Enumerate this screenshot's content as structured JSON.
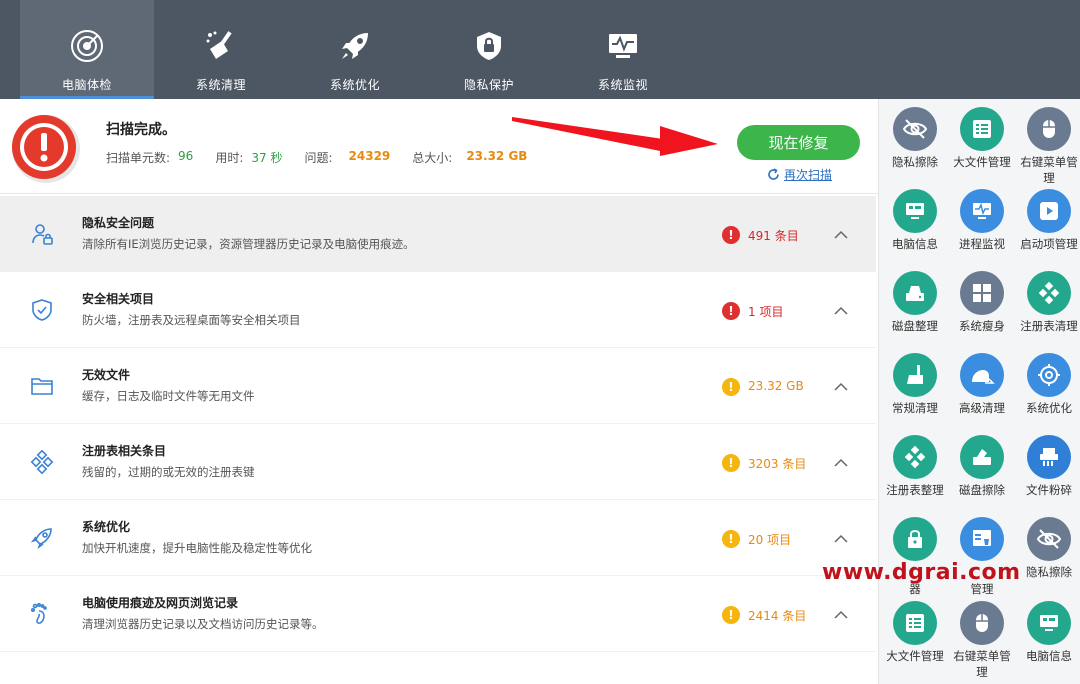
{
  "nav": {
    "tabs": [
      {
        "label": "电脑体检",
        "icon": "radar-icon"
      },
      {
        "label": "系统清理",
        "icon": "broom-icon"
      },
      {
        "label": "系统优化",
        "icon": "rocket-icon"
      },
      {
        "label": "隐私保护",
        "icon": "lock-shield-icon"
      },
      {
        "label": "系统监视",
        "icon": "monitor-icon"
      }
    ]
  },
  "summary": {
    "title": "扫描完成。",
    "units_label": "扫描单元数:",
    "units_value": "96",
    "time_label": "用时:",
    "time_value": "37 秒",
    "issues_label": "问题:",
    "issues_value": "24329",
    "size_label": "总大小:",
    "size_value": "23.32 GB",
    "fix_button": "现在修复",
    "rescan_link": "再次扫描"
  },
  "issues": [
    {
      "title": "隐私安全问题",
      "desc": "清除所有IE浏览历史记录，资源管理器历史记录及电脑使用痕迹。",
      "count": "491 条目",
      "severity": "red",
      "icon": "user-lock-icon"
    },
    {
      "title": "安全相关项目",
      "desc": "防火墙，注册表及远程桌面等安全相关项目",
      "count": "1 项目",
      "severity": "red",
      "icon": "shield-check-icon"
    },
    {
      "title": "无效文件",
      "desc": "缓存，日志及临时文件等无用文件",
      "count": "23.32 GB",
      "severity": "yellow",
      "icon": "folder-icon"
    },
    {
      "title": "注册表相关条目",
      "desc": "残留的，过期的或无效的注册表键",
      "count": "3203 条目",
      "severity": "yellow",
      "icon": "registry-icon"
    },
    {
      "title": "系统优化",
      "desc": "加快开机速度，提升电脑性能及稳定性等优化",
      "count": "20 项目",
      "severity": "yellow",
      "icon": "rocket-icon"
    },
    {
      "title": "电脑使用痕迹及网页浏览记录",
      "desc": "清理浏览器历史记录以及文档访问历史记录等。",
      "count": "2414 条目",
      "severity": "yellow",
      "icon": "footprint-icon"
    }
  ],
  "tools": [
    {
      "label": "隐私擦除",
      "icon": "eye-off-icon",
      "color": "#6a7a90"
    },
    {
      "label": "大文件管理",
      "icon": "file-list-icon",
      "color": "#23a88e"
    },
    {
      "label": "右键菜单管理",
      "icon": "mouse-icon",
      "color": "#6a7a90"
    },
    {
      "label": "电脑信息",
      "icon": "computer-icon",
      "color": "#23a88e"
    },
    {
      "label": "进程监视",
      "icon": "monitor-pulse-icon",
      "color": "#3b8de0"
    },
    {
      "label": "启动项管理",
      "icon": "play-icon",
      "color": "#3b8de0"
    },
    {
      "label": "磁盘整理",
      "icon": "disk-icon",
      "color": "#23a88e"
    },
    {
      "label": "系统瘦身",
      "icon": "windows-icon",
      "color": "#6a7a90"
    },
    {
      "label": "注册表清理",
      "icon": "registry-icon",
      "color": "#23a88e"
    },
    {
      "label": "常规清理",
      "icon": "broom-icon",
      "color": "#23a88e"
    },
    {
      "label": "高级清理",
      "icon": "vacuum-icon",
      "color": "#3b8de0"
    },
    {
      "label": "系统优化",
      "icon": "gear-icon",
      "color": "#3b8de0"
    },
    {
      "label": "注册表整理",
      "icon": "registry-icon",
      "color": "#23a88e"
    },
    {
      "label": "磁盘擦除",
      "icon": "disk-erase-icon",
      "color": "#23a88e"
    },
    {
      "label": "文件粉碎",
      "icon": "shredder-icon",
      "color": "#3b8de0"
    },
    {
      "label": "器",
      "icon": "lock-icon",
      "color": "#23a88e"
    },
    {
      "label": "管理",
      "icon": "window-alert-icon",
      "color": "#3b8de0"
    },
    {
      "label": "隐私擦除",
      "icon": "eye-off-icon",
      "color": "#6a7a90"
    },
    {
      "label": "大文件管理",
      "icon": "file-list-icon",
      "color": "#23a88e"
    },
    {
      "label": "右键菜单管理",
      "icon": "mouse-icon",
      "color": "#6a7a90"
    },
    {
      "label": "电脑信息",
      "icon": "computer-icon",
      "color": "#23a88e"
    }
  ],
  "watermark": "www.dgrai.com"
}
